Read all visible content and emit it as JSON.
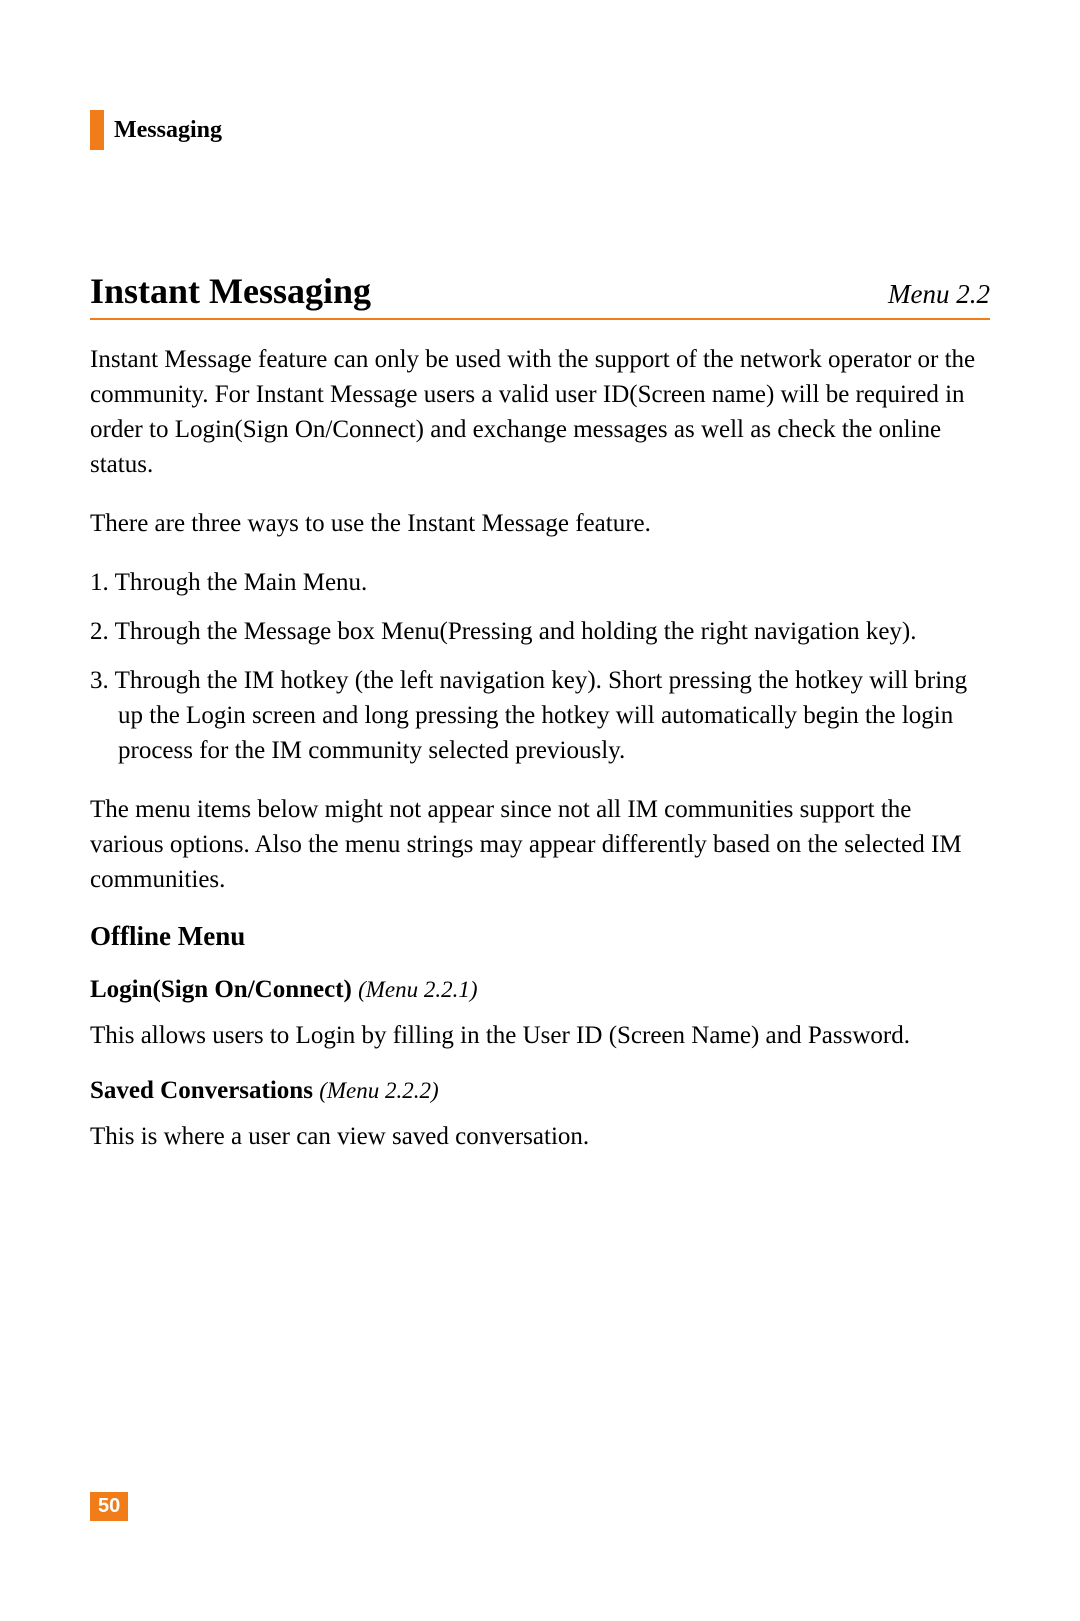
{
  "header": {
    "section": "Messaging"
  },
  "title": "Instant Messaging",
  "menu": "Menu 2.2",
  "intro": "Instant Message feature can only be used with the support of the network operator or the community. For Instant Message users a valid user ID(Screen name) will be required in order to Login(Sign On/Connect) and exchange messages as well as check the online status.",
  "ways_intro": "There are three ways to use the Instant Message feature.",
  "list": [
    "Through the Main Menu.",
    "Through the Message box Menu(Pressing and holding the right navigation key).",
    "Through the IM hotkey (the left navigation key). Short pressing the hotkey will bring up the Login screen and long pressing the hotkey will automatically begin the login process for the IM community selected previously."
  ],
  "note": "The menu items below might not appear since not all IM communities support the various options. Also the menu strings may appear differently based on the selected IM communities.",
  "offline": {
    "heading": "Offline Menu",
    "login": {
      "title": "Login(Sign On/Connect)",
      "menu": "(Menu 2.2.1)",
      "body": "This allows users to Login by filling in the User ID (Screen Name) and Password."
    },
    "saved": {
      "title": "Saved Conversations",
      "menu": "(Menu 2.2.2)",
      "body": "This is where a user can view saved conversation."
    }
  },
  "page_number": "50"
}
